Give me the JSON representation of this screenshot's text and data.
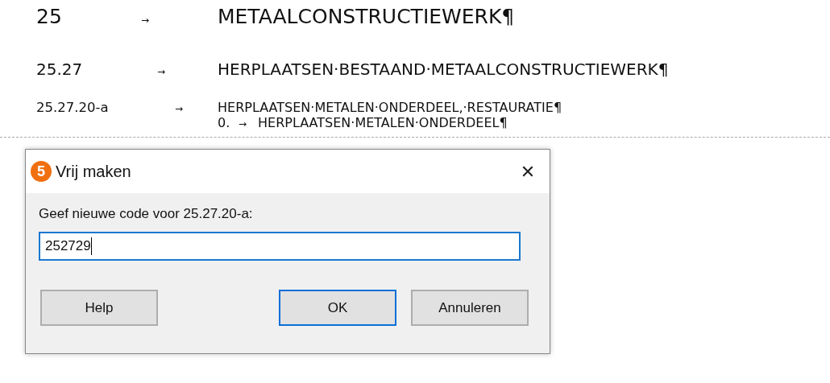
{
  "document": {
    "entries": [
      {
        "kind": "chapter",
        "code": "25",
        "arrow": "→",
        "title": "METAALCONSTRUCTIEWERK¶"
      },
      {
        "kind": "section",
        "code": "25.27",
        "arrow": "→",
        "title": "HERPLAATSEN·BESTAAND·METAALCONSTRUCTIEWERK¶"
      },
      {
        "kind": "item",
        "code": "25.27.20-a",
        "arrow": "→",
        "title": "HERPLAATSEN·METALEN·ONDERDEEL,·RESTAURATIE¶",
        "subline": {
          "number": "0.",
          "arrow": "→",
          "text": "HERPLAATSEN·METALEN·ONDERDEEL¶"
        }
      }
    ]
  },
  "dialog": {
    "logo": "5",
    "title": "Vrij maken",
    "close": "✕",
    "prompt": "Geef nieuwe code voor 25.27.20-a:",
    "value": "252729",
    "buttons": [
      {
        "label": "Help",
        "default": false
      },
      {
        "label": "OK",
        "default": true
      },
      {
        "label": "Annuleren",
        "default": false
      }
    ]
  }
}
